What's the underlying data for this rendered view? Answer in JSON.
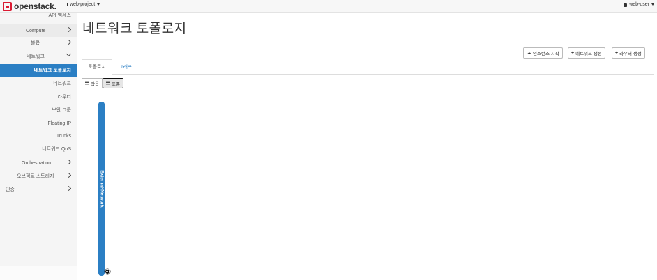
{
  "navbar": {
    "brand": "openstack.",
    "project": "web-project",
    "user": "web-user"
  },
  "sidebar": {
    "items": [
      {
        "label": "API 액세스"
      },
      {
        "label": "Compute"
      },
      {
        "label": "볼륨"
      },
      {
        "label": "네트워크"
      },
      {
        "label": "네트워크 토폴로지"
      },
      {
        "label": "네트워크"
      },
      {
        "label": "라우터"
      },
      {
        "label": "보안 그룹"
      },
      {
        "label": "Floating IP"
      },
      {
        "label": "Trunks"
      },
      {
        "label": "네트워크 QoS"
      },
      {
        "label": "Orchestration"
      },
      {
        "label": "오브젝트 스토리지"
      },
      {
        "label": "인증"
      }
    ]
  },
  "main": {
    "title": "네트워크 토폴로지",
    "actions": {
      "launch_instance": "인스턴스 시작",
      "create_network": "네트워크 생성",
      "create_router": "라우터 생성"
    },
    "tabs": [
      "토폴로지",
      "그래프"
    ],
    "view_modes": {
      "compact": "작음",
      "normal": "표준"
    },
    "topology": {
      "network_name": "External-Network",
      "network_color": "#2b7fc4"
    }
  },
  "icons": [
    "openstack-logo-icon",
    "project-icon",
    "user-icon",
    "chevron-right-icon",
    "chevron-down-icon",
    "cloud-upload-icon",
    "plus-icon",
    "grid-icon",
    "globe-icon"
  ],
  "colors": {
    "accent": "#2b7fc4",
    "brand": "#da1a32"
  }
}
